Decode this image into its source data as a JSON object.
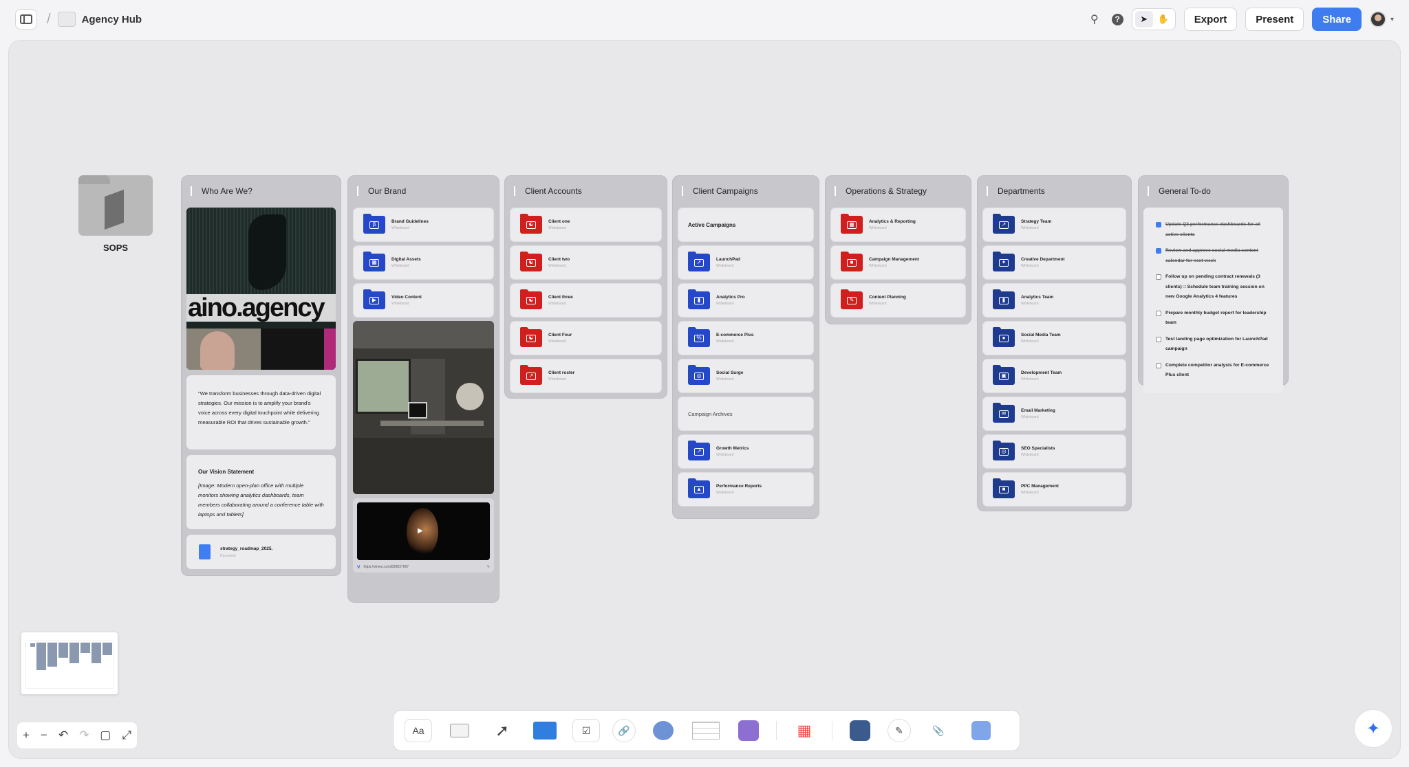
{
  "topbar": {
    "title": "Agency Hub",
    "export": "Export",
    "present": "Present",
    "share": "Share"
  },
  "sops": {
    "label": "SOPS"
  },
  "who": {
    "title": "Who Are We?",
    "logo": "aino.agency",
    "quote": "\"We transform businesses through data-driven digital strategies. Our mission is to amplify your brand's voice across every digital touchpoint while delivering measurable ROI that drives sustainable growth.\"",
    "vision_title": "Our Vision Statement",
    "vision_body": "[Image: Modern open-plan office with multiple monitors showing analytics dashboards, team members collaborating around a conference table with laptops and tablets]",
    "doc_name": "strategy_roadmap_2025.",
    "doc_sub": "Document"
  },
  "brand": {
    "title": "Our Brand",
    "items": [
      {
        "name": "Brand Guidelines",
        "sub": "Whiteboard"
      },
      {
        "name": "Digital Assets",
        "sub": "Whiteboard"
      },
      {
        "name": "Video Content",
        "sub": "Whiteboard"
      }
    ],
    "video_url": "https://vimeo.com/828037067"
  },
  "clients": {
    "title": "Client Accounts",
    "items": [
      {
        "name": "Client one",
        "sub": "Whiteboard"
      },
      {
        "name": "Client two",
        "sub": "Whiteboard"
      },
      {
        "name": "Client three",
        "sub": "Whiteboard"
      },
      {
        "name": "Client Four",
        "sub": "Whiteboard"
      },
      {
        "name": "Client roster",
        "sub": "Whiteboard"
      }
    ]
  },
  "campaigns": {
    "title": "Client Campaigns",
    "active": "Active Campaigns",
    "archives": "Campaign Archives",
    "items": [
      {
        "name": "LaunchPad",
        "sub": "Whiteboard"
      },
      {
        "name": "Analytics Pro",
        "sub": "Whiteboard"
      },
      {
        "name": "E-commerce Plus",
        "sub": "Whiteboard"
      },
      {
        "name": "Social Surge",
        "sub": "Whiteboard"
      }
    ],
    "archive_items": [
      {
        "name": "Growth Metrics",
        "sub": "Whiteboard"
      },
      {
        "name": "Performance Reports",
        "sub": "Whiteboard"
      }
    ]
  },
  "ops": {
    "title": "Operations & Strategy",
    "items": [
      {
        "name": "Analytics & Reporting",
        "sub": "Whiteboard"
      },
      {
        "name": "Campaign Management",
        "sub": "Whiteboard"
      },
      {
        "name": "Content Planning",
        "sub": "Whiteboard"
      }
    ]
  },
  "depts": {
    "title": "Departments",
    "items": [
      {
        "name": "Strategy Team",
        "sub": "Whiteboard"
      },
      {
        "name": "Creative Department",
        "sub": "Whiteboard"
      },
      {
        "name": "Analytics Team",
        "sub": "Whiteboard"
      },
      {
        "name": "Social Media Team",
        "sub": "Whiteboard"
      },
      {
        "name": "Development Team",
        "sub": "Whiteboard"
      },
      {
        "name": "Email Marketing",
        "sub": "Whiteboard"
      },
      {
        "name": "SEO Specialists",
        "sub": "Whiteboard"
      },
      {
        "name": "PPC Management",
        "sub": "Whiteboard"
      }
    ]
  },
  "todo": {
    "title": "General To-do",
    "items": [
      {
        "text": "Update Q3 performance dashboards for all active clients",
        "done": true
      },
      {
        "text": "Review and approve social media content calendar for next week",
        "done": true
      },
      {
        "text": "Follow up on pending contract renewals (3 clients) □ Schedule team training session on new Google Analytics 4 features",
        "done": false
      },
      {
        "text": "Prepare monthly budget report for leadership team",
        "done": false
      },
      {
        "text": "Test landing page optimization for LaunchPad campaign",
        "done": false
      },
      {
        "text": "Complete competitor analysis for E-commerce Plus client",
        "done": false
      }
    ]
  },
  "dock": {
    "text_tool": "Aa"
  }
}
